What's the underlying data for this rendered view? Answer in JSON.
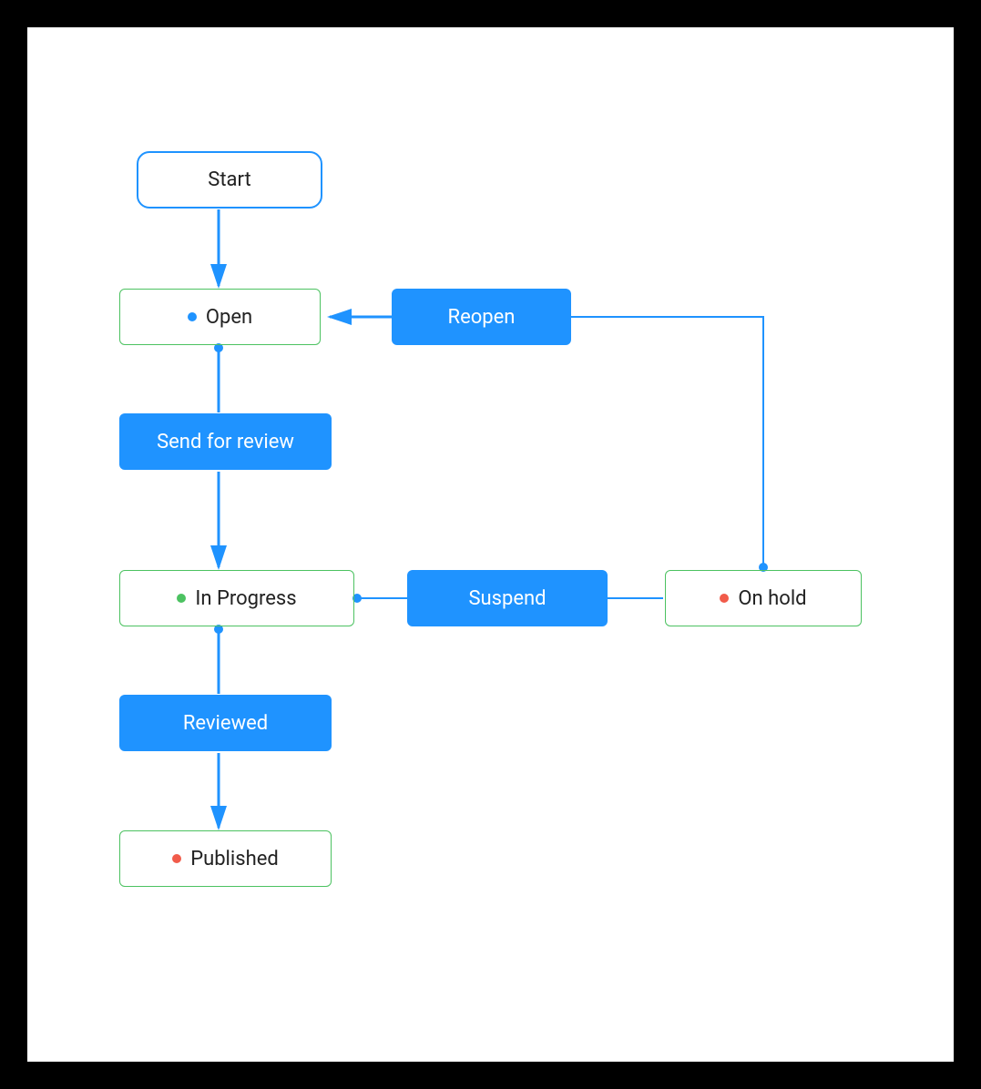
{
  "flow": {
    "start_label": "Start",
    "states": {
      "open": "Open",
      "in_progress": "In Progress",
      "on_hold": "On hold",
      "published": "Published"
    },
    "actions": {
      "reopen": "Reopen",
      "send_for_review": "Send for review",
      "suspend": "Suspend",
      "reviewed": "Reviewed"
    }
  },
  "colors": {
    "accent_blue": "#1F93FF",
    "state_green": "#4CC261",
    "dot_red": "#F15B4A"
  }
}
